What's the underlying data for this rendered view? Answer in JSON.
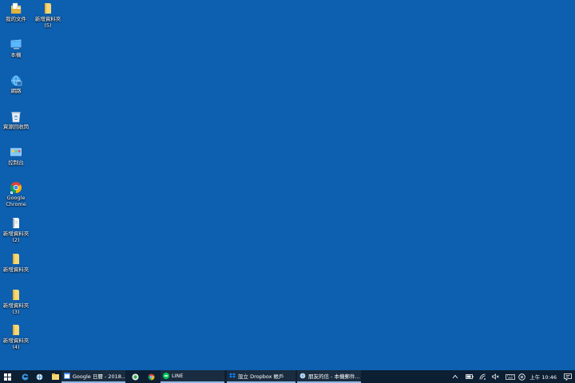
{
  "desktop": {
    "icons": [
      {
        "label": "我的文件"
      },
      {
        "label": "新增資料夾\n(5)"
      },
      {
        "label": "本機"
      },
      {
        "label": "網路"
      },
      {
        "label": "資源回收筒"
      },
      {
        "label": "控制台"
      },
      {
        "label": "Google\nChrome"
      },
      {
        "label": "新增資料夾\n(2)"
      },
      {
        "label": "新增資料夾"
      },
      {
        "label": "新增資料夾\n(3)"
      },
      {
        "label": "新增資料夾\n(4)"
      }
    ]
  },
  "taskbar": {
    "apps": [
      {
        "label": "Google 日曆 - 2018..."
      },
      {
        "label": "LINE"
      },
      {
        "label": "設立 Dropbox 帳戶"
      },
      {
        "label": "朋友的信 - 本機郵件..."
      }
    ],
    "clock": "上午 10:46"
  },
  "colors": {
    "desktop_bg": "#0d5fb0",
    "taskbar_bg": "#0c1f33",
    "active_underline": "#8fb7e6"
  }
}
